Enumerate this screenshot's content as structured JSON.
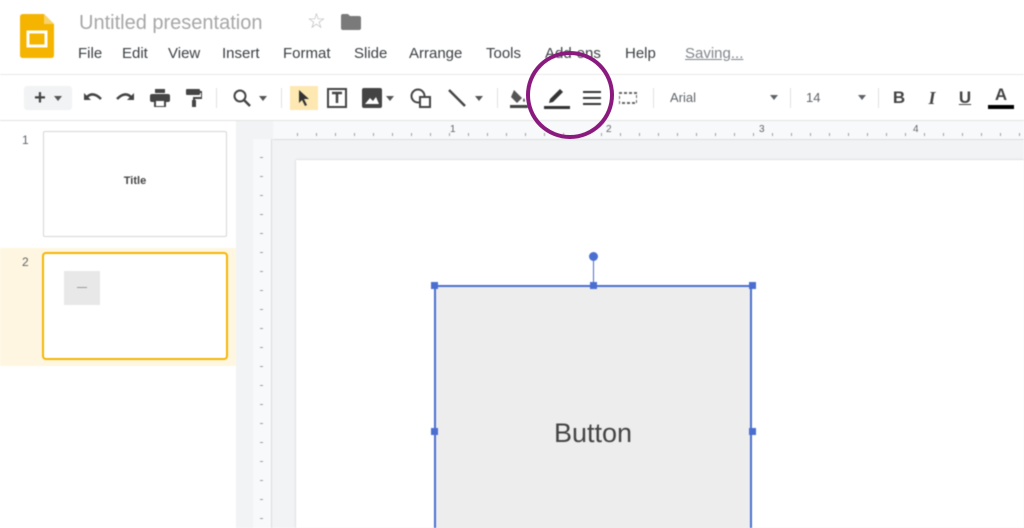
{
  "app": {
    "title": "Untitled presentation",
    "accent_color": "#f4b400",
    "highlight_color": "#8a1a7e",
    "selection_color": "#4a6fd1"
  },
  "menu": {
    "items": [
      "File",
      "Edit",
      "View",
      "Insert",
      "Format",
      "Slide",
      "Arrange",
      "Tools",
      "Add-ons",
      "Help"
    ],
    "status": "Saving..."
  },
  "toolbar": {
    "icons": [
      "new-slide-icon",
      "undo-icon",
      "redo-icon",
      "print-icon",
      "paint-format-icon",
      "zoom-icon",
      "select-icon",
      "text-box-icon",
      "image-icon",
      "shape-icon",
      "line-icon",
      "fill-color-icon",
      "border-color-icon",
      "border-weight-icon",
      "border-dash-icon",
      "bold-icon",
      "italic-icon",
      "underline-icon",
      "text-color-icon"
    ],
    "font_family": "Arial",
    "font_size": "14",
    "add_label": "+"
  },
  "slides": [
    {
      "number": "1",
      "title": "Title"
    },
    {
      "number": "2",
      "selected": true,
      "shape_label": "—"
    }
  ],
  "rulers": {
    "h_labels": [
      "1",
      "2",
      "3",
      "4"
    ]
  },
  "canvas": {
    "shape_text": "Button"
  }
}
